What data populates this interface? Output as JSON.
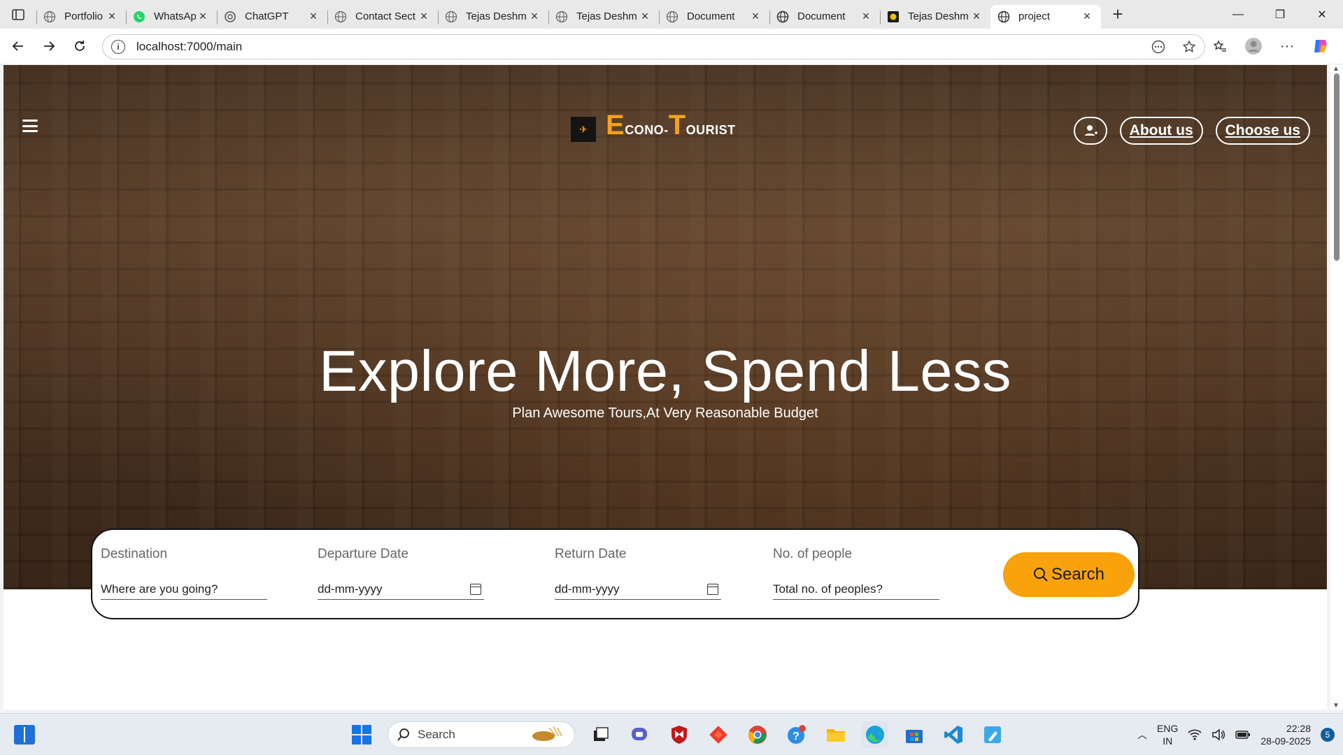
{
  "browser": {
    "tabs": [
      {
        "title": "Portfolio",
        "icon": "globe-icon"
      },
      {
        "title": "WhatsApp",
        "icon": "whatsapp-icon"
      },
      {
        "title": "ChatGPT",
        "icon": "chatgpt-icon"
      },
      {
        "title": "Contact Sect",
        "icon": "globe-icon"
      },
      {
        "title": "Tejas Deshm",
        "icon": "globe-icon"
      },
      {
        "title": "Tejas Deshm",
        "icon": "globe-icon"
      },
      {
        "title": "Document",
        "icon": "globe-icon"
      },
      {
        "title": "Document",
        "icon": "globe-icon"
      },
      {
        "title": "Tejas Deshm",
        "icon": "app-icon"
      },
      {
        "title": "project",
        "icon": "globe-icon",
        "active": true
      }
    ],
    "url": "localhost:7000/main"
  },
  "site": {
    "brand": {
      "big1": "E",
      "rest1": "CONO-",
      "big2": "T",
      "rest2": "OURIST"
    },
    "nav": {
      "about": "About us",
      "choose": "Choose us"
    },
    "headline": "Explore More, Spend Less",
    "subline": "Plan Awesome Tours,At Very Reasonable Budget",
    "search": {
      "destination": {
        "label": "Destination",
        "placeholder": "Where are you going?"
      },
      "departure": {
        "label": "Departure Date",
        "placeholder": "dd-mm-yyyy"
      },
      "return": {
        "label": "Return Date",
        "placeholder": "dd-mm-yyyy"
      },
      "people": {
        "label": "No. of people",
        "placeholder": "Total no. of peoples?"
      },
      "button": "Search"
    },
    "accent_color": "#f9a20b"
  },
  "taskbar": {
    "search_label": "Search",
    "lang_top": "ENG",
    "lang_bottom": "IN",
    "time": "22:28",
    "date": "28-09-2025",
    "notifications": "5"
  }
}
